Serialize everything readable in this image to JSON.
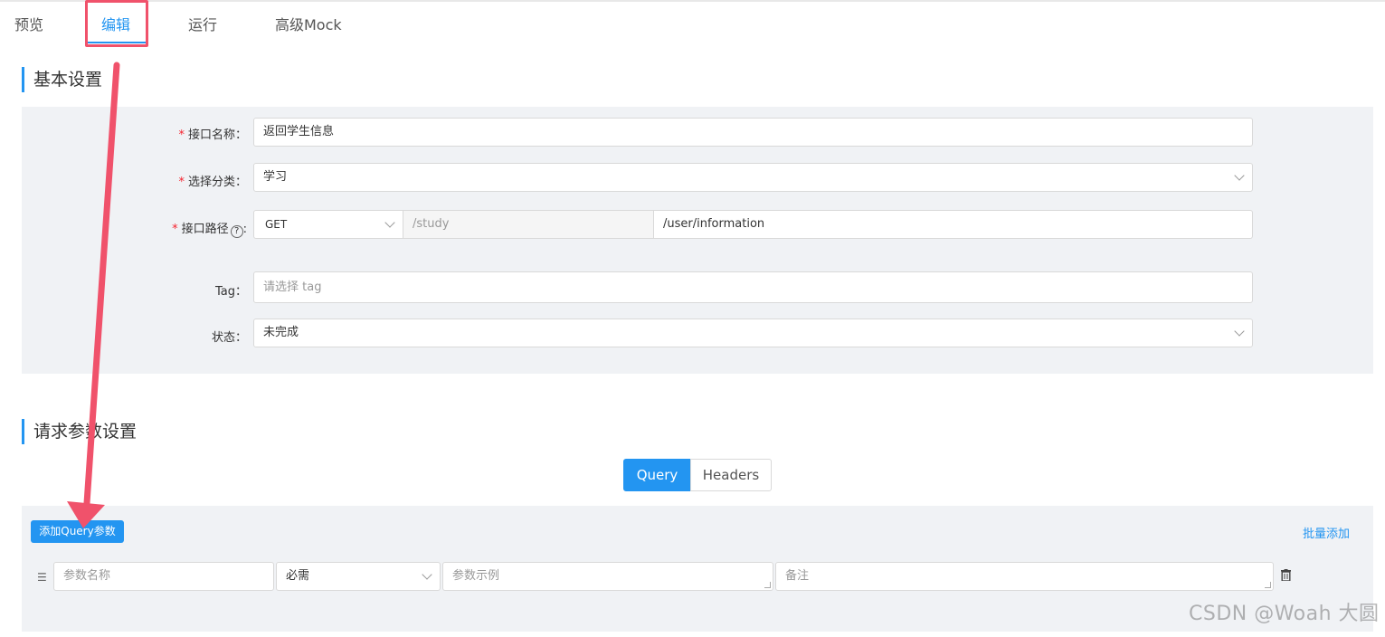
{
  "tabs": [
    "预览",
    "编辑",
    "运行",
    "高级Mock"
  ],
  "sections": {
    "basic": "基本设置",
    "request": "请求参数设置"
  },
  "form": {
    "name_label": "接口名称：",
    "name_value": "返回学生信息",
    "category_label": "选择分类：",
    "category_value": "学习",
    "path_label": "接口路径",
    "path_label_suffix": ":",
    "help_glyph": "?",
    "method_value": "GET",
    "base_path": "/study",
    "path_value": "/user/information",
    "tag_label": "Tag：",
    "tag_placeholder": "请选择 tag",
    "status_label": "状态：",
    "status_value": "未完成",
    "required_mark": "*"
  },
  "params": {
    "tab_query": "Query",
    "tab_headers": "Headers",
    "add_button": "添加Query参数",
    "bulk_add": "批量添加",
    "name_placeholder": "参数名称",
    "required_value": "必需",
    "example_placeholder": "参数示例",
    "note_placeholder": "备注"
  },
  "watermark": "CSDN @Woah 大圆",
  "colors": {
    "accent": "#2395f1",
    "highlight": "#f0526b",
    "panel": "#f0f2f5"
  }
}
